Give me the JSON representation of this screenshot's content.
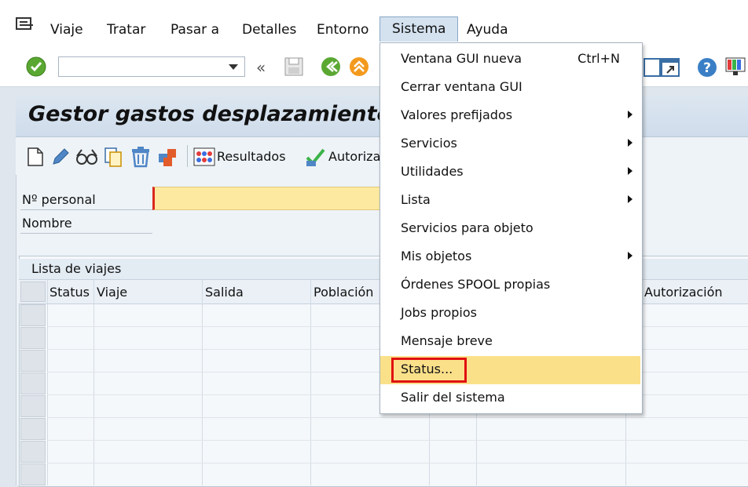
{
  "menubar": {
    "items": [
      {
        "label": "Viaje"
      },
      {
        "label": "Tratar"
      },
      {
        "label": "Pasar a"
      },
      {
        "label": "Detalles"
      },
      {
        "label": "Entorno"
      },
      {
        "label": "Sistema"
      },
      {
        "label": "Ayuda"
      }
    ]
  },
  "toolbar": {
    "command_field_value": ""
  },
  "screen": {
    "title": "Gestor gastos desplazamiento",
    "results_button": "Resultados",
    "authorize_button": "Autorizar"
  },
  "form": {
    "personal_label": "Nº personal",
    "personal_value": "",
    "name_label": "Nombre"
  },
  "trip_table": {
    "caption": "Lista de viajes",
    "columns": [
      "Status",
      "Viaje",
      "Salida",
      "Población",
      "Autorización"
    ]
  },
  "system_menu": {
    "items": [
      {
        "label": "Ventana GUI nueva",
        "shortcut": "Ctrl+N"
      },
      {
        "label": "Cerrar ventana GUI"
      },
      {
        "label": "Valores prefijados",
        "submenu": true
      },
      {
        "label": "Servicios",
        "submenu": true
      },
      {
        "label": "Utilidades",
        "submenu": true
      },
      {
        "label": "Lista",
        "submenu": true
      },
      {
        "label": "Servicios para objeto"
      },
      {
        "label": "Mis objetos",
        "submenu": true
      },
      {
        "label": "Órdenes SPOOL propias"
      },
      {
        "label": "Jobs propios"
      },
      {
        "label": "Mensaje breve"
      },
      {
        "label": "Status...",
        "highlighted": true
      },
      {
        "label": "Salir del sistema"
      }
    ]
  },
  "colors": {
    "highlight": "#fbe08a",
    "callout": "#e01010",
    "required_field": "#fdeaa0"
  }
}
